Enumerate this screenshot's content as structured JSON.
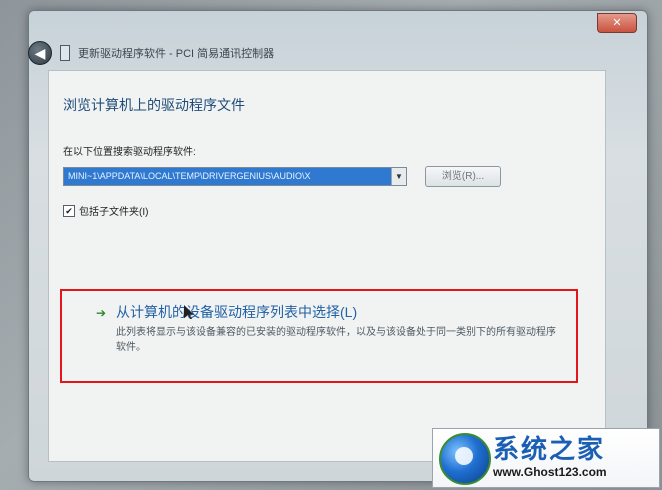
{
  "window": {
    "close_glyph": "✕",
    "title": "更新驱动程序软件 - PCI 简易通讯控制器",
    "back_glyph": "◀"
  },
  "dialog": {
    "heading": "浏览计算机上的驱动程序文件",
    "search_label": "在以下位置搜索驱动程序软件:",
    "path_value": "MINI~1\\APPDATA\\LOCAL\\TEMP\\DRIVERGENIUS\\AUDIO\\X",
    "browse_label": "浏览(R)...",
    "include_subfolders_label": "包括子文件夹(I)",
    "include_subfolders_checked": "✔",
    "pick_option": {
      "arrow": "➔",
      "title": "从计算机的设备驱动程序列表中选择(L)",
      "description": "此列表将显示与该设备兼容的已安装的驱动程序软件，以及与该设备处于同一类别下的所有驱动程序软件。"
    }
  },
  "watermark": {
    "name": "系统之家",
    "url": "www.Ghost123.com"
  },
  "colors": {
    "highlight": "#e3161b",
    "link": "#2161a5",
    "heading": "#1f4c78"
  }
}
